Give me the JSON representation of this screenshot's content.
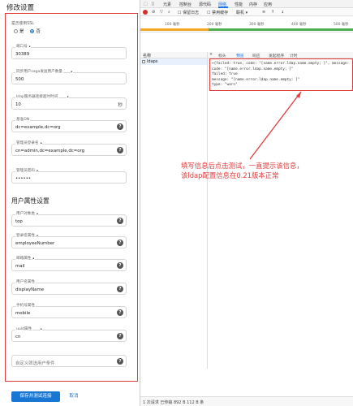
{
  "form": {
    "title": "修改设置",
    "ssl": {
      "label": "是否使用SSL",
      "options": [
        "是",
        "否"
      ],
      "selected": "否"
    },
    "fields": [
      {
        "label": "端口号",
        "required": true,
        "value": "30389"
      },
      {
        "label": "同步用户saga发送用户数量",
        "required": true,
        "value": "500"
      },
      {
        "label": "ldap服务器连接超时时间",
        "required": true,
        "value": "10",
        "suffix": "秒"
      },
      {
        "label": "基准DN",
        "required": false,
        "value": "dc=example,dc=org"
      },
      {
        "label": "管理员登录名",
        "required": true,
        "value": "cn=admin,dc=example,dc=org"
      },
      {
        "label": "管理员密码",
        "required": true,
        "value": "••••••"
      }
    ],
    "user_section_title": "用户属性设置",
    "user_fields": [
      {
        "label": "用户对象类",
        "required": true,
        "value": "top"
      },
      {
        "label": "登录名属性",
        "required": true,
        "value": "employeeNumber"
      },
      {
        "label": "邮箱属性",
        "required": true,
        "value": "mail"
      },
      {
        "label": "用户名属性",
        "required": false,
        "value": "displayName"
      },
      {
        "label": "手机号属性",
        "required": false,
        "value": "mobile"
      },
      {
        "label": "uuid属性",
        "required": true,
        "value": "cn"
      },
      {
        "label": "",
        "required": false,
        "value": "自定义筛选用户条件"
      }
    ],
    "save_button": "保存并测试连接",
    "cancel_button": "取消"
  },
  "devtools": {
    "tabs": [
      "元素",
      "控制台",
      "源代码",
      "网络",
      "性能",
      "内存",
      "应用"
    ],
    "active_tab": "网络",
    "toolbar": {
      "preserve_log": "保留日志",
      "disable_cache": "禁用缓存",
      "throttle": "联机"
    },
    "timeline_ticks": [
      "100 毫秒",
      "200 毫秒",
      "300 毫秒",
      "400 毫秒",
      "500 毫秒"
    ],
    "name_column": "名称",
    "request_name": "ldaps",
    "detail_tabs": [
      "标头",
      "预览",
      "响应",
      "发起程序",
      "计时"
    ],
    "active_detail_tab": "预览",
    "json_lines": [
      "▾{failed: true, code: \"[name.error.ldap.name.empty; ]\", message:",
      "  code: \"[name.error.ldap.name.empty; ]\"",
      "  failed: true",
      "  message: \"[name.error.ldap.name.empty; ]\"",
      "  type: \"warn\""
    ],
    "status": "1 次请求  已传输 892 B  112 B 条"
  },
  "annotation": {
    "lines": [
      "填写信息后点击测试，一直提示该信息，",
      "该ldap配置信息在0.21版本正常"
    ]
  },
  "colors": {
    "primary": "#1976d2",
    "annotation": "#e23b3b"
  }
}
